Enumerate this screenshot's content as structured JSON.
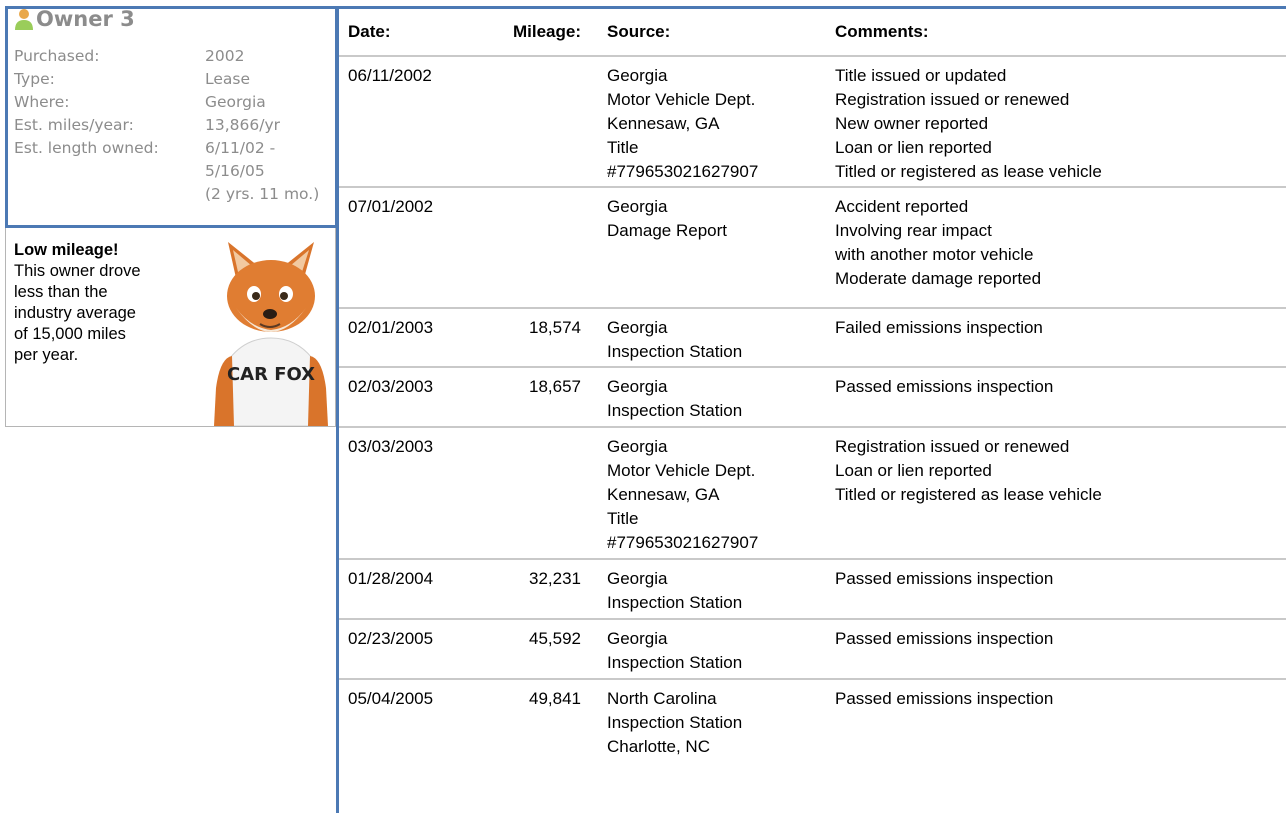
{
  "owner": {
    "title": "Owner 3",
    "details": [
      {
        "label": "Purchased:",
        "value": "2002"
      },
      {
        "label": "Type:",
        "value": "Lease"
      },
      {
        "label": "Where:",
        "value": "Georgia"
      },
      {
        "label": "Est. miles/year:",
        "value": "13,866/yr"
      },
      {
        "label": "Est. length owned:",
        "value": "6/11/02 -"
      },
      {
        "label": "",
        "value": "5/16/05"
      },
      {
        "label": "",
        "value": "(2 yrs. 11 mo.)"
      }
    ]
  },
  "tip": {
    "title": "Low mileage!",
    "lines": [
      "This owner drove",
      "less than the",
      "industry average",
      "of 15,000 miles",
      "per year."
    ],
    "fox_shirt": "CAR FOX"
  },
  "table": {
    "headers": {
      "date": "Date:",
      "mileage": "Mileage:",
      "source": "Source:",
      "comments": "Comments:"
    },
    "rows": [
      {
        "date": "06/11/2002",
        "mileage": "",
        "source": [
          "Georgia",
          "Motor Vehicle Dept.",
          "Kennesaw, GA",
          "Title",
          "#779653021627907"
        ],
        "comments": [
          "Title issued or updated",
          "Registration issued or renewed",
          "New owner reported",
          "Loan or lien reported",
          "Titled or registered as lease vehicle"
        ]
      },
      {
        "date": "07/01/2002",
        "mileage": "",
        "source": [
          "Georgia",
          "Damage Report"
        ],
        "comments": [
          "Accident reported",
          "Involving rear impact",
          "with another motor vehicle",
          "Moderate damage reported"
        ]
      },
      {
        "date": "02/01/2003",
        "mileage": "18,574",
        "source": [
          "Georgia",
          "Inspection Station"
        ],
        "comments": [
          "Failed emissions inspection"
        ]
      },
      {
        "date": "02/03/2003",
        "mileage": "18,657",
        "source": [
          "Georgia",
          "Inspection Station"
        ],
        "comments": [
          "Passed emissions inspection"
        ]
      },
      {
        "date": "03/03/2003",
        "mileage": "",
        "source": [
          "Georgia",
          "Motor Vehicle Dept.",
          "Kennesaw, GA",
          "Title",
          "#779653021627907"
        ],
        "comments": [
          "Registration issued or renewed",
          "Loan or lien reported",
          "Titled or registered as lease vehicle"
        ]
      },
      {
        "date": "01/28/2004",
        "mileage": "32,231",
        "source": [
          "Georgia",
          "Inspection Station"
        ],
        "comments": [
          "Passed emissions inspection"
        ]
      },
      {
        "date": "02/23/2005",
        "mileage": "45,592",
        "source": [
          "Georgia",
          "Inspection Station"
        ],
        "comments": [
          "Passed emissions inspection"
        ]
      },
      {
        "date": "05/04/2005",
        "mileage": "49,841",
        "source": [
          "North Carolina",
          "Inspection Station",
          "Charlotte, NC"
        ],
        "comments": [
          "Passed emissions inspection"
        ]
      }
    ]
  },
  "colors": {
    "accent": "#4c79b4",
    "muted": "#8c8c8c",
    "divider": "#c9c9c9",
    "person_icon": "#9acd5a"
  }
}
